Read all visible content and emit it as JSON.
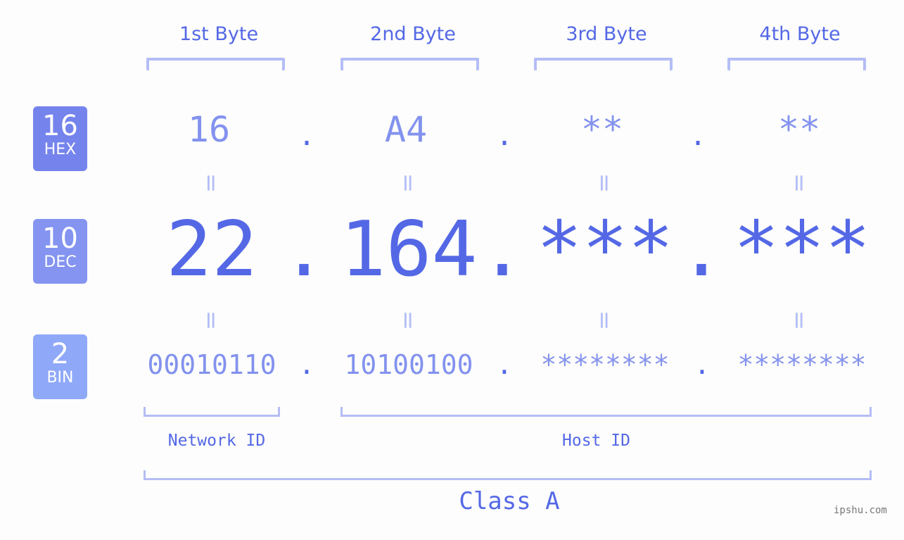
{
  "bytes": [
    {
      "label": "1st Byte",
      "hex": "16",
      "dec": "22",
      "bin": "00010110"
    },
    {
      "label": "2nd Byte",
      "hex": "A4",
      "dec": "164",
      "bin": "10100100"
    },
    {
      "label": "3rd Byte",
      "hex": "**",
      "dec": "***",
      "bin": "********"
    },
    {
      "label": "4th Byte",
      "hex": "**",
      "dec": "***",
      "bin": "********"
    }
  ],
  "separator": ".",
  "equals": "=",
  "badges": {
    "hex": {
      "number": "16",
      "label": "HEX",
      "color": "#7584ec"
    },
    "dec": {
      "number": "10",
      "label": "DEC",
      "color": "#8494f0"
    },
    "bin": {
      "number": "2",
      "label": "BIN",
      "color": "#8fa8f8"
    }
  },
  "network_id_label": "Network ID",
  "host_id_label": "Host ID",
  "class_label": "Class A",
  "watermark": "ipshu.com",
  "colors": {
    "accent": "#5468e6",
    "light": "#8392ee",
    "bracket": "#b4bdf6"
  }
}
